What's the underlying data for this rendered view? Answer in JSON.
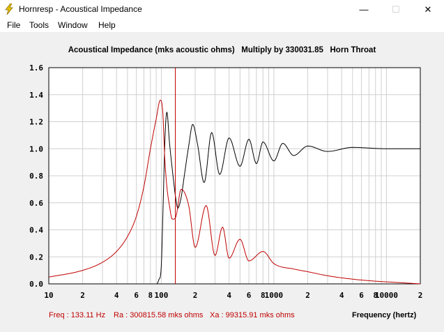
{
  "window": {
    "title": "Hornresp - Acoustical Impedance",
    "minimize_glyph": "—",
    "maximize_glyph": "☐",
    "close_glyph": "✕",
    "icon": "lightning-icon"
  },
  "menu": [
    "File",
    "Tools",
    "Window",
    "Help"
  ],
  "chart_title": "Acoustical Impedance (mks acoustic ohms)   Multiply by 330031.85   Horn Throat",
  "status": {
    "freq": "Freq : 133.11 Hz",
    "ra": "Ra : 300815.58 mks ohms",
    "xa": "Xa : 99315.91 mks ohms"
  },
  "x_unit_label": "Frequency (hertz)",
  "chart_data": {
    "type": "line",
    "x_scale": "log",
    "xlim": [
      10,
      20000
    ],
    "ylim": [
      0,
      1.6
    ],
    "grid": true,
    "x_tick_labels": [
      {
        "v": 10,
        "t": "10"
      },
      {
        "v": 20,
        "t": "2"
      },
      {
        "v": 40,
        "t": "4"
      },
      {
        "v": 60,
        "t": "6"
      },
      {
        "v": 80,
        "t": "8"
      },
      {
        "v": 100,
        "t": "100"
      },
      {
        "v": 200,
        "t": "2"
      },
      {
        "v": 400,
        "t": "4"
      },
      {
        "v": 600,
        "t": "6"
      },
      {
        "v": 800,
        "t": "8"
      },
      {
        "v": 1000,
        "t": "1000"
      },
      {
        "v": 2000,
        "t": "2"
      },
      {
        "v": 4000,
        "t": "4"
      },
      {
        "v": 6000,
        "t": "6"
      },
      {
        "v": 8000,
        "t": "8"
      },
      {
        "v": 10000,
        "t": "10000"
      },
      {
        "v": 20000,
        "t": "2"
      }
    ],
    "y_tick_labels": [
      "0.0",
      "0.2",
      "0.4",
      "0.6",
      "0.8",
      "1.0",
      "1.2",
      "1.4",
      "1.6"
    ],
    "cursor_x": 133.11,
    "series": [
      {
        "color": "#000000",
        "x": [
          10,
          80,
          95,
          100,
          104,
          108,
          112,
          118,
          125,
          135,
          140,
          150,
          160,
          175,
          190,
          210,
          240,
          280,
          330,
          400,
          500,
          600,
          700,
          800,
          1000,
          1200,
          1500,
          2000,
          3000,
          5000,
          10000,
          20000
        ],
        "y": [
          0.0,
          0.0,
          0.03,
          0.14,
          0.62,
          1.1,
          1.27,
          1.05,
          0.85,
          0.62,
          0.56,
          0.64,
          0.8,
          1.02,
          1.18,
          1.03,
          0.75,
          1.12,
          0.81,
          1.08,
          0.87,
          1.07,
          0.89,
          1.05,
          0.91,
          1.04,
          0.95,
          1.02,
          0.98,
          1.01,
          1.0,
          1.0
        ]
      },
      {
        "color": "#c00000",
        "x": [
          10,
          20,
          30,
          40,
          50,
          60,
          70,
          80,
          90,
          98,
          103,
          107,
          112,
          118,
          125,
          135,
          150,
          175,
          200,
          250,
          300,
          350,
          400,
          500,
          600,
          800,
          1000,
          1500,
          2000,
          3000,
          5000,
          8000,
          10000,
          20000
        ],
        "y": [
          0.05,
          0.1,
          0.16,
          0.24,
          0.35,
          0.5,
          0.72,
          1.0,
          1.22,
          1.36,
          1.27,
          0.95,
          0.72,
          0.58,
          0.48,
          0.5,
          0.7,
          0.58,
          0.27,
          0.58,
          0.21,
          0.42,
          0.19,
          0.33,
          0.17,
          0.24,
          0.15,
          0.11,
          0.09,
          0.06,
          0.035,
          0.02,
          0.015,
          0.0
        ]
      }
    ]
  }
}
